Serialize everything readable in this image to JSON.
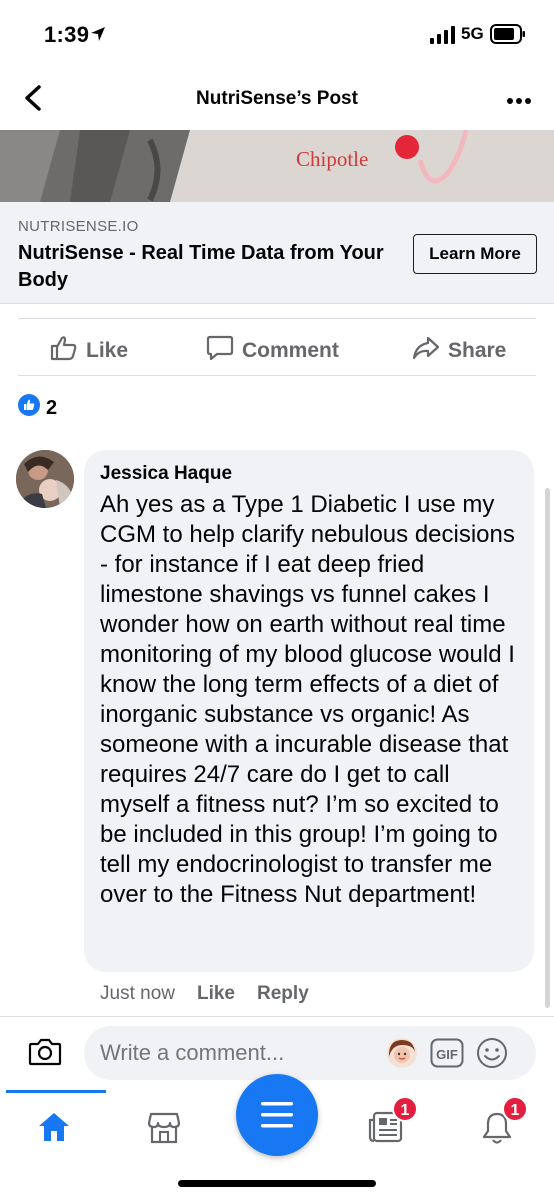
{
  "status_bar": {
    "time": "1:39",
    "network": "5G"
  },
  "header": {
    "title": "NutriSense’s Post"
  },
  "ad": {
    "image_caption": "Chipotle",
    "domain": "NUTRISENSE.IO",
    "title": "NutriSense - Real Time Data from Your Body",
    "cta_label": "Learn More"
  },
  "actions": {
    "like": "Like",
    "comment": "Comment",
    "share": "Share"
  },
  "reactions": {
    "count": "2"
  },
  "comment": {
    "author": "Jessica Haque",
    "text": "Ah yes as a Type 1 Diabetic I use my CGM to help clarify nebulous decisions - for instance if I eat deep fried limestone shavings vs funnel cakes I wonder how on earth without real time monitoring of my blood glucose would I know the long term effects of a diet of inorganic substance vs organic! As someone with a incurable disease that requires 24/7 care do I get to call myself a fitness nut?  I’m so excited to be included in this group!  I’m going to tell my endocrinologist to transfer me over to the Fitness Nut department!",
    "timestamp": "Just now",
    "like_label": "Like",
    "reply_label": "Reply"
  },
  "composer": {
    "placeholder": "Write a comment...",
    "gif_label": "GIF"
  },
  "bottom_nav": {
    "feeds_badge": "1",
    "notifications_badge": "1"
  },
  "colors": {
    "accent": "#1877f2",
    "badge": "#e41e3f",
    "secondary_text": "#65676b",
    "bubble_bg": "#f0f2f5"
  }
}
